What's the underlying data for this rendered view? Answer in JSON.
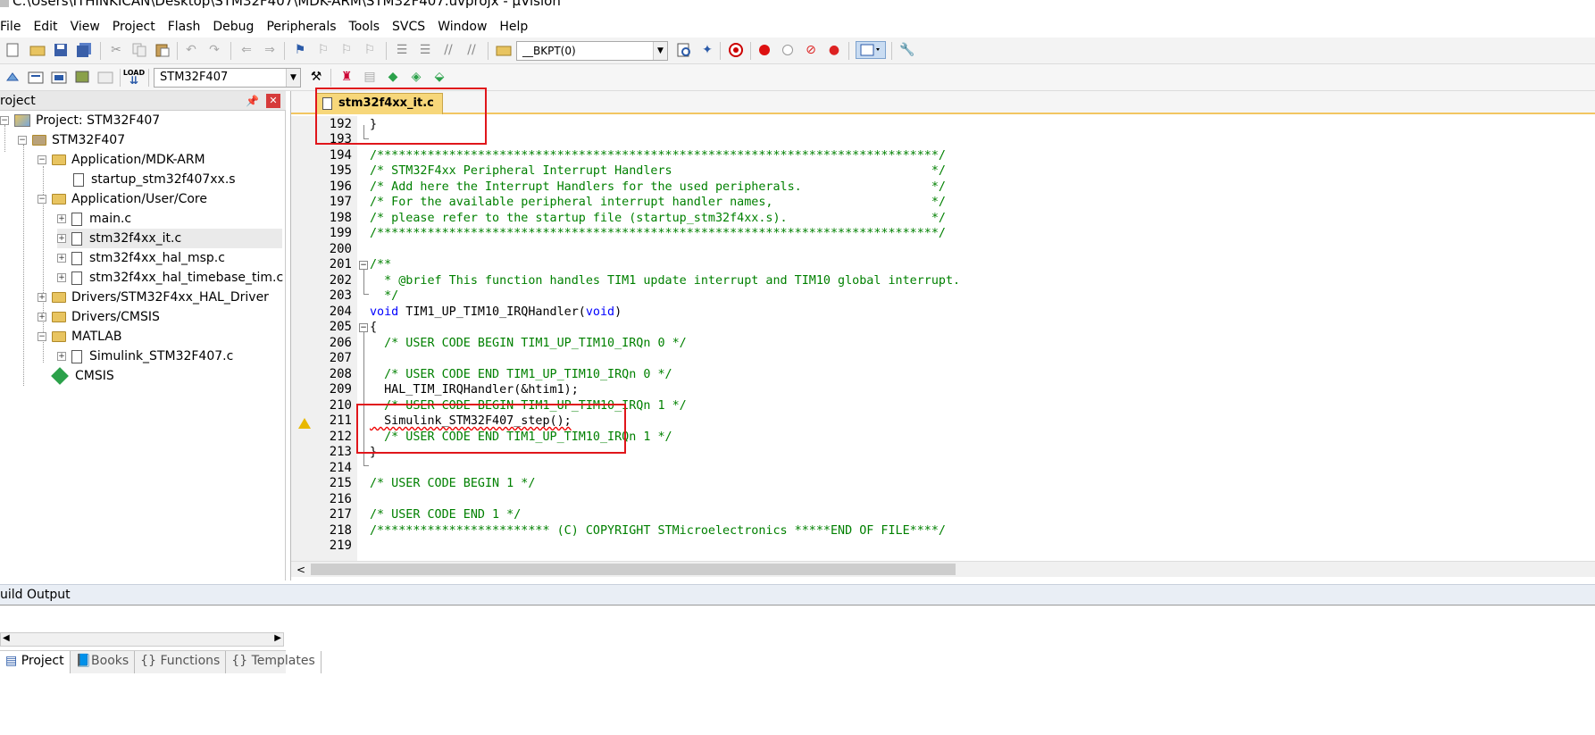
{
  "window": {
    "title": "C:\\Users\\ITHINKICAN\\Desktop\\STM32F407\\MDK-ARM\\STM32F407.uvprojx - µVision"
  },
  "menu": [
    "File",
    "Edit",
    "View",
    "Project",
    "Flash",
    "Debug",
    "Peripherals",
    "Tools",
    "SVCS",
    "Window",
    "Help"
  ],
  "toolbar": {
    "bkpt_combo": "__BKPT(0)",
    "target_combo": "STM32F407"
  },
  "project_panel": {
    "header": "roject",
    "tree": [
      "Project: STM32F407",
      "STM32F407",
      "Application/MDK-ARM",
      "startup_stm32f407xx.s",
      "Application/User/Core",
      "main.c",
      "stm32f4xx_it.c",
      "stm32f4xx_hal_msp.c",
      "stm32f4xx_hal_timebase_tim.c",
      "Drivers/STM32F4xx_HAL_Driver",
      "Drivers/CMSIS",
      "MATLAB",
      "Simulink_STM32F407.c",
      "CMSIS"
    ],
    "tabs": [
      "Project",
      "Books",
      "Functions",
      "Templates"
    ]
  },
  "editor": {
    "active_tab": "stm32f4xx_it.c",
    "line_numbers": [
      "192",
      "193",
      "194",
      "195",
      "196",
      "197",
      "198",
      "199",
      "200",
      "201",
      "202",
      "203",
      "204",
      "205",
      "206",
      "207",
      "208",
      "209",
      "210",
      "211",
      "212",
      "213",
      "214",
      "215",
      "216",
      "217",
      "218",
      "219"
    ],
    "lines": {
      "l192": "}",
      "l194": "/******************************************************************************/",
      "l195": "/* STM32F4xx Peripheral Interrupt Handlers                                    */",
      "l196": "/* Add here the Interrupt Handlers for the used peripherals.                  */",
      "l197": "/* For the available peripheral interrupt handler names,                      */",
      "l198": "/* please refer to the startup file (startup_stm32f4xx.s).                    */",
      "l199": "/******************************************************************************/",
      "l201": "/**",
      "l202": "  * @brief This function handles TIM1 update interrupt and TIM10 global interrupt.",
      "l203": "  */",
      "l204_kw1": "void",
      "l204_name": " TIM1_UP_TIM10_IRQHandler(",
      "l204_kw2": "void",
      "l204_end": ")",
      "l205": "{",
      "l206": "  /* USER CODE BEGIN TIM1_UP_TIM10_IRQn 0 */",
      "l208": "  /* USER CODE END TIM1_UP_TIM10_IRQn 0 */",
      "l209": "  HAL_TIM_IRQHandler(&htim1);",
      "l210": "  /* USER CODE BEGIN TIM1_UP_TIM10_IRQn 1 */",
      "l211": "  Simulink_STM32F407_step();",
      "l212": "  /* USER CODE END TIM1_UP_TIM10_IRQn 1 */",
      "l213": "}",
      "l215": "/* USER CODE BEGIN 1 */",
      "l217": "/* USER CODE END 1 */",
      "l218": "/************************ (C) COPYRIGHT STMicroelectronics *****END OF FILE****/"
    }
  },
  "build_output": {
    "label": "uild Output"
  },
  "colors": {
    "comment": "#008000",
    "keyword": "#0000ff",
    "annotation": "#e0161b",
    "tab_active": "#f7d77a"
  },
  "icons": [
    "new-file-icon",
    "open-icon",
    "save-icon",
    "save-all-icon",
    "cut-icon",
    "copy-icon",
    "paste-icon",
    "undo-icon",
    "redo-icon",
    "nav-back-icon",
    "nav-forward-icon",
    "bookmark-icon",
    "indent-icon",
    "outdent-icon",
    "comment-icon",
    "uncomment-icon",
    "find-in-files-icon",
    "debug-session-icon",
    "breakpoint-icon",
    "breakpoint-disable-icon",
    "build-icon",
    "rebuild-icon",
    "download-icon",
    "options-icon",
    "warning-icon"
  ]
}
